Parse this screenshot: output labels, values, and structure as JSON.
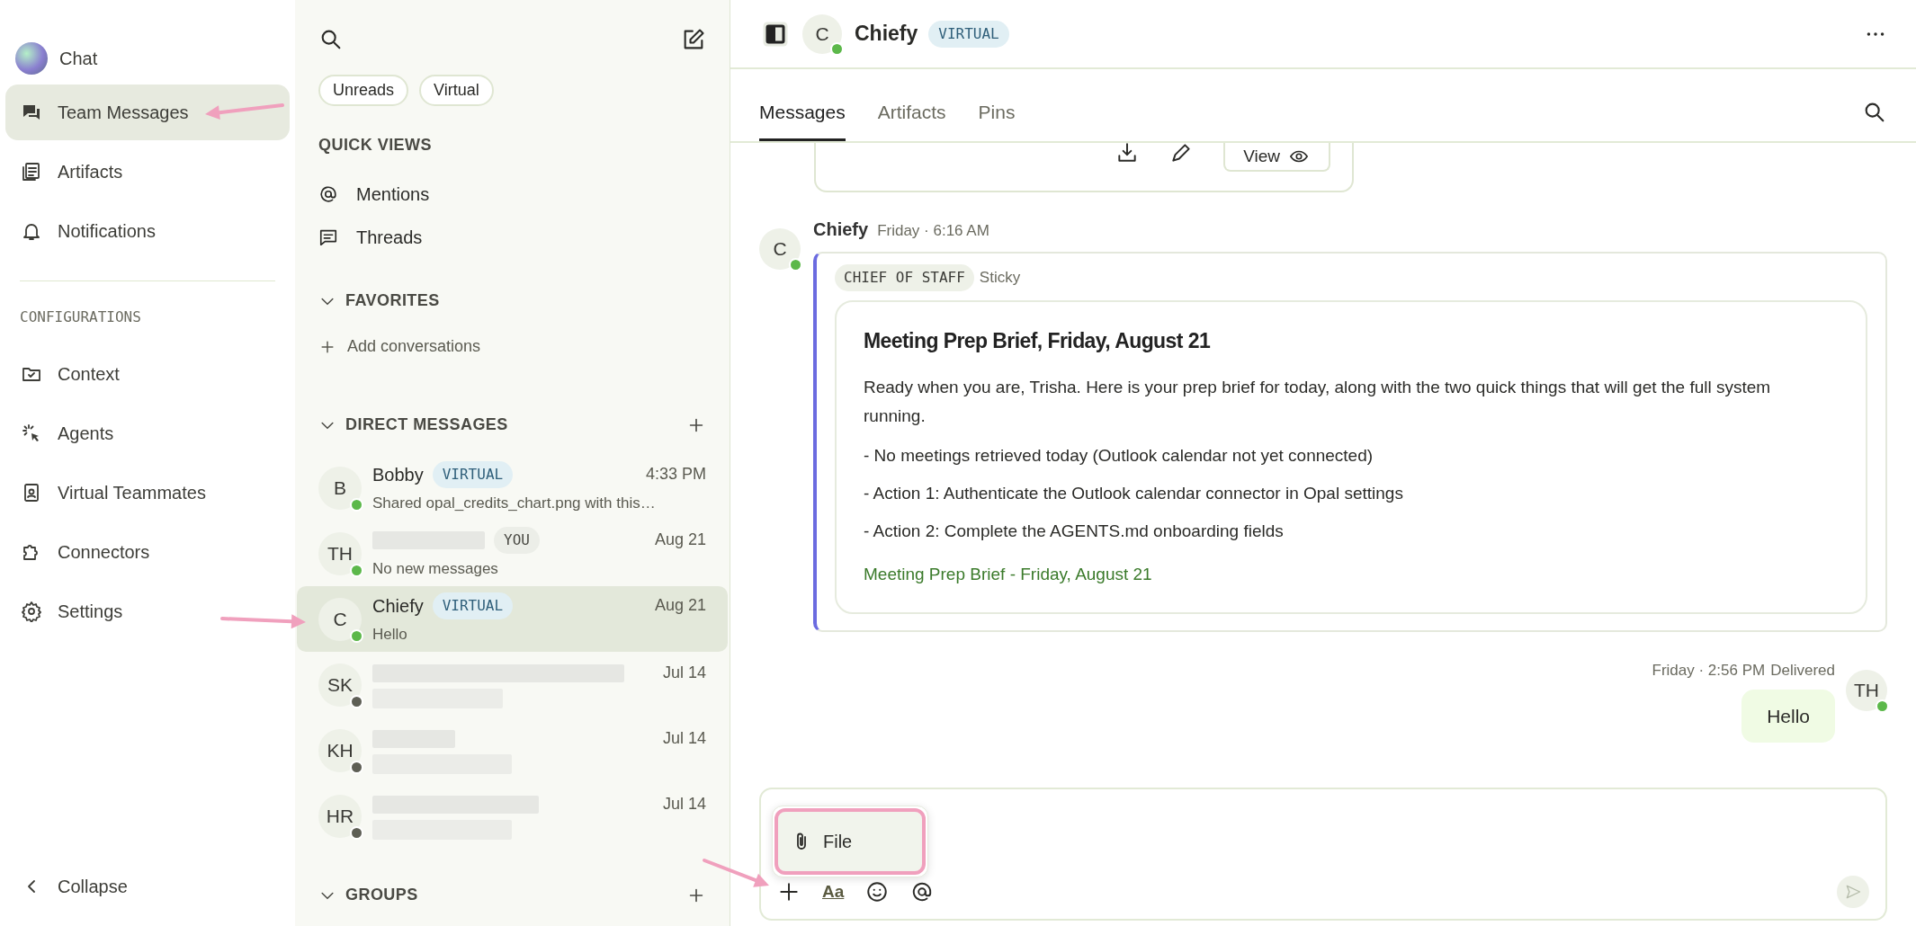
{
  "nav": {
    "items": [
      {
        "label": "Chat",
        "selected": false
      },
      {
        "label": "Team Messages",
        "selected": true
      },
      {
        "label": "Artifacts",
        "selected": false
      },
      {
        "label": "Notifications",
        "selected": false
      }
    ],
    "section_label": "CONFIGURATIONS",
    "config_items": [
      {
        "label": "Context",
        "selected": false
      },
      {
        "label": "Agents",
        "selected": false
      },
      {
        "label": "Virtual Teammates",
        "selected": false
      },
      {
        "label": "Connectors",
        "selected": false
      },
      {
        "label": "Settings",
        "selected": false
      }
    ],
    "collapse": "Collapse"
  },
  "conversations": {
    "filters": [
      "Unreads",
      "Virtual"
    ],
    "quick_views": {
      "title": "QUICK VIEWS",
      "items": [
        {
          "label": "Mentions"
        },
        {
          "label": "Threads"
        }
      ]
    },
    "favorites": {
      "title": "FAVORITES",
      "expanded": true,
      "add_label": "Add conversations"
    },
    "direct_messages": {
      "title": "DIRECT MESSAGES",
      "expanded": true,
      "rows": [
        {
          "initials": "B",
          "name": "Bobby",
          "badge": {
            "text": "VIRTUAL",
            "kind": "virtual"
          },
          "time": "4:33 PM",
          "preview": "Shared opal_credits_chart.png with this…",
          "online": true,
          "selected": false
        },
        {
          "initials": "TH",
          "badge": {
            "text": "YOU",
            "kind": "self"
          },
          "time": "Aug 21",
          "preview": "No new messages",
          "online": true,
          "selected": false
        },
        {
          "initials": "C",
          "name": "Chiefy",
          "badge": {
            "text": "VIRTUAL",
            "kind": "virtual"
          },
          "time": "Aug 21",
          "preview": "Hello",
          "online": true,
          "selected": true
        },
        {
          "initials": "SK",
          "time": "Jul 14",
          "online": false,
          "selected": false
        },
        {
          "initials": "KH",
          "time": "Jul 14",
          "online": false,
          "selected": false
        },
        {
          "initials": "HR",
          "time": "Jul 14",
          "online": false,
          "selected": false
        }
      ]
    },
    "groups": {
      "title": "GROUPS",
      "expanded": true
    }
  },
  "header": {
    "initials": "C",
    "online": true,
    "name": "Chiefy",
    "badge": {
      "text": "VIRTUAL",
      "kind": "virtual"
    }
  },
  "tabs": [
    {
      "label": "Messages",
      "selected": true
    },
    {
      "label": "Artifacts",
      "selected": false
    },
    {
      "label": "Pins",
      "selected": false
    }
  ],
  "messages": [
    {
      "kind": "artifact_cut",
      "view_label": "View"
    },
    {
      "kind": "incoming",
      "initials": "C",
      "online": true,
      "author": "Chiefy",
      "time": "Friday · 6:16 AM",
      "tag": "CHIEF OF STAFF",
      "tag_note": "Sticky",
      "card": {
        "title": "Meeting Prep Brief, Friday, August 21",
        "paragraphs": [
          "Ready when you are, Trisha. Here is your prep brief for today, along with the two quick things that will get the full system running.",
          "- No meetings retrieved today (Outlook calendar not yet connected)",
          "- Action 1: Authenticate the Outlook calendar connector in Opal settings",
          "- Action 2: Complete the AGENTS.md onboarding fields"
        ],
        "link": "Meeting Prep Brief - Friday, August 21"
      }
    },
    {
      "kind": "outgoing",
      "time": "Friday · 2:56 PM",
      "status": "Delivered",
      "text": "Hello",
      "initials": "TH",
      "online": true
    }
  ],
  "composer": {
    "menu": [
      {
        "label": "File",
        "highlighted": true
      }
    ],
    "format_label": "Aa"
  }
}
